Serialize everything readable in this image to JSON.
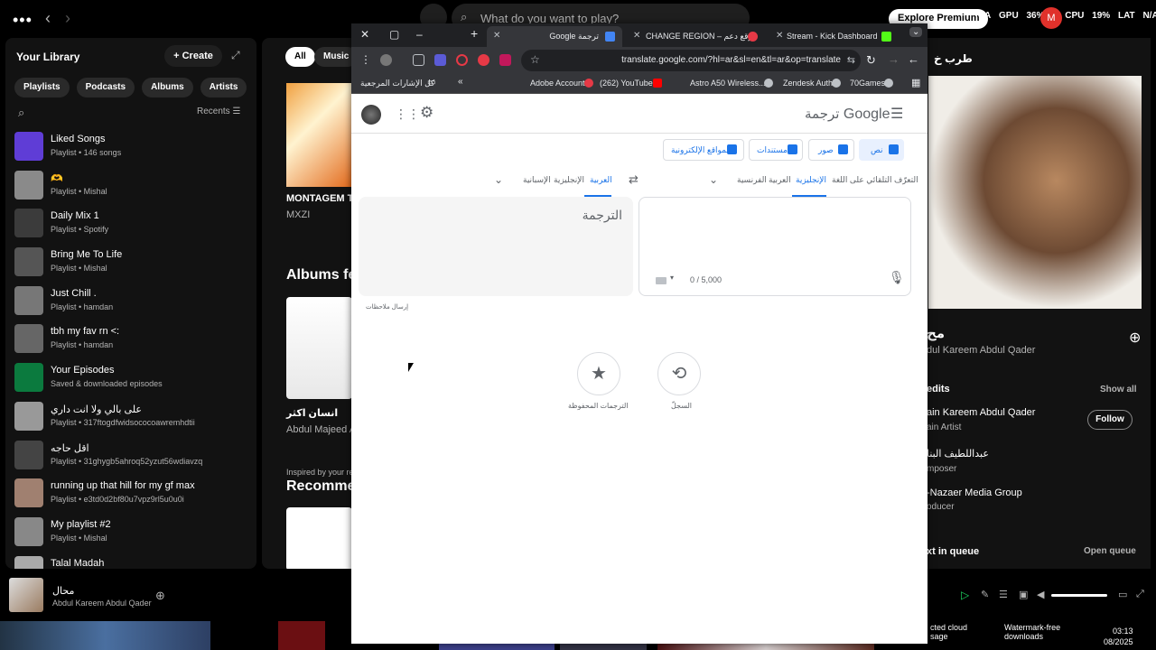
{
  "spotify": {
    "search_placeholder": "What do you want to play?",
    "explore_label": "Explore Premium",
    "sys_stats": [
      "N/A",
      "GPU",
      "36%",
      "CPU",
      "19%",
      "LAT",
      "N/A"
    ],
    "rec_label": "M",
    "library": {
      "title": "Your Library",
      "create_label": "Create",
      "chips": [
        "Playlists",
        "Podcasts",
        "Albums",
        "Artists"
      ],
      "recents_label": "Recents",
      "items": [
        {
          "name": "Liked Songs",
          "sub": "Playlist • 146 songs",
          "color": "#5f3dd6"
        },
        {
          "name": "🫶",
          "sub": "Playlist • Mishal",
          "color": "#8a8a8a"
        },
        {
          "name": "Daily Mix 1",
          "sub": "Playlist • Spotify",
          "color": "#3b3b3b"
        },
        {
          "name": "Bring Me To Life",
          "sub": "Playlist • Mishal",
          "color": "#555"
        },
        {
          "name": "Just Chill .",
          "sub": "Playlist • hamdan",
          "color": "#777"
        },
        {
          "name": "tbh my fav rn <:",
          "sub": "Playlist • hamdan",
          "color": "#666"
        },
        {
          "name": "Your Episodes",
          "sub": "Saved & downloaded episodes",
          "color": "#0b7a3e"
        },
        {
          "name": "على بالي ولا انت داري",
          "sub": "Playlist • 317ftogdfwidsococoawremhdtii",
          "color": "#999"
        },
        {
          "name": "اقل حاجه",
          "sub": "Playlist • 31ghygb5ahroq52yzut56wdiavzq",
          "color": "#444"
        },
        {
          "name": "running up that hill for my gf max",
          "sub": "Playlist • e3td0d2bf80u7vpz9rl5u0u0i",
          "color": "#a08070"
        },
        {
          "name": "My playlist #2",
          "sub": "Playlist • Mishal",
          "color": "#888"
        },
        {
          "name": "Talal Madah",
          "sub": "",
          "color": "#aaa"
        }
      ]
    },
    "main": {
      "chips": [
        "All",
        "Music"
      ],
      "album1_title": "MONTAGEM TO",
      "album1_artist": "MXZI",
      "albums_heading": "Albums fe",
      "album2_title": "انسان اكثر",
      "album2_artist": "Abdul Majeed Ab",
      "inspired": "Inspired by your rec",
      "recommended_heading": "Recomme"
    },
    "right": {
      "heading": "طرب خ",
      "track_title": "مح",
      "track_artist": "dul Kareem Abdul Qader",
      "credits_label": "edits",
      "show_all": "Show all",
      "credit1_name": "ain Kareem Abdul Qader",
      "credit1_role": "ain Artist",
      "follow_label": "Follow",
      "credit2_name": "عبداللطيف البنا",
      "credit2_role": "mposer",
      "credit3_name": "-Nazaer Media Group",
      "credit3_role": "oducer",
      "next_label": "xt in queue",
      "open_queue": "Open queue"
    },
    "player": {
      "title": "محال",
      "artist": "Abdul Kareem Abdul Qader"
    },
    "taskbar": {
      "cloud": "cted cloud\nsage",
      "watermark": "Watermark-free\ndownloads",
      "time": "03:13",
      "date": "08/2025"
    }
  },
  "browser": {
    "tabs": [
      {
        "label": "Google ترجمة",
        "active": true
      },
      {
        "label": "CHANGE REGION – موقع دعم",
        "active": false
      },
      {
        "label": "Stream - Kick Dashboard",
        "active": false
      }
    ],
    "url": "translate.google.com/?hl=ar&sl=en&tl=ar&op=translate",
    "bookmarks": [
      {
        "label": "كل الإشارات المرجعية"
      },
      {
        "label": "Adobe Account"
      },
      {
        "label": "(262) YouTube"
      },
      {
        "label": "Astro A50 Wireless..."
      },
      {
        "label": "Zendesk Auth"
      },
      {
        "label": "70Games"
      }
    ]
  },
  "translate": {
    "logo_google": "Google",
    "logo_suffix": "ترجمة",
    "modes": {
      "text": "نص",
      "images": "صور",
      "documents": "مستندات",
      "websites": "المواقع الإلكترونية"
    },
    "source_langs": [
      "التعرّف التلقائي على اللغة",
      "الإنجليزية",
      "العربية",
      "الفرنسية"
    ],
    "target_langs": [
      "العربية",
      "الإنجليزية",
      "الإسبانية"
    ],
    "counter": "0 / 5,000",
    "target_placeholder": "الترجمة",
    "feedback": "إرسال ملاحظات",
    "history_label": "السجلّ",
    "saved_label": "الترجمات المحفوظة"
  }
}
